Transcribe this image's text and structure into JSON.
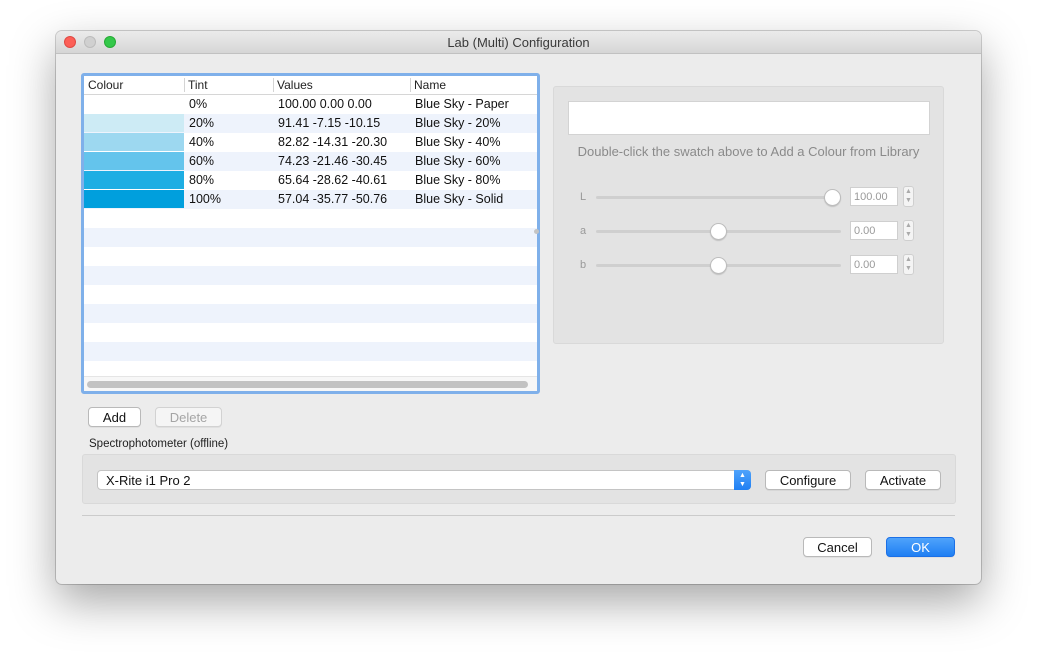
{
  "window": {
    "title": "Lab (Multi) Configuration"
  },
  "table": {
    "columns": [
      "Colour",
      "Tint",
      "Values",
      "Name"
    ],
    "rows": [
      {
        "swatch": "#ffffff",
        "tint": "0%",
        "values": "100.00 0.00 0.00",
        "name": "Blue Sky - Paper"
      },
      {
        "swatch": "#cdebf5",
        "tint": "20%",
        "values": "91.41 -7.15 -10.15",
        "name": "Blue Sky - 20%"
      },
      {
        "swatch": "#9dd8f0",
        "tint": "40%",
        "values": "82.82 -14.31 -20.30",
        "name": "Blue Sky - 40%"
      },
      {
        "swatch": "#64c4ec",
        "tint": "60%",
        "values": "74.23 -21.46 -30.45",
        "name": "Blue Sky - 60%"
      },
      {
        "swatch": "#1eaee3",
        "tint": "80%",
        "values": "65.64 -28.62 -40.61",
        "name": "Blue Sky - 80%"
      },
      {
        "swatch": "#009fdd",
        "tint": "100%",
        "values": "57.04 -35.77 -50.76",
        "name": "Blue Sky - Solid"
      }
    ]
  },
  "editor": {
    "hint": "Double-click the swatch above to Add a Colour from Library",
    "sliders": [
      {
        "label": "L",
        "value": "100.00",
        "level": 1.0
      },
      {
        "label": "a",
        "value": "0.00",
        "level": 0.5
      },
      {
        "label": "b",
        "value": "0.00",
        "level": 0.5
      }
    ]
  },
  "buttons": {
    "add": "Add",
    "delete": "Delete",
    "configure": "Configure",
    "activate": "Activate",
    "cancel": "Cancel",
    "ok": "OK"
  },
  "spectrophotometer": {
    "label": "Spectrophotometer (offline)",
    "device": "X-Rite i1 Pro 2"
  },
  "colors": {
    "accent": "#1f7ff3",
    "focus_ring": "#7fb0ea"
  }
}
